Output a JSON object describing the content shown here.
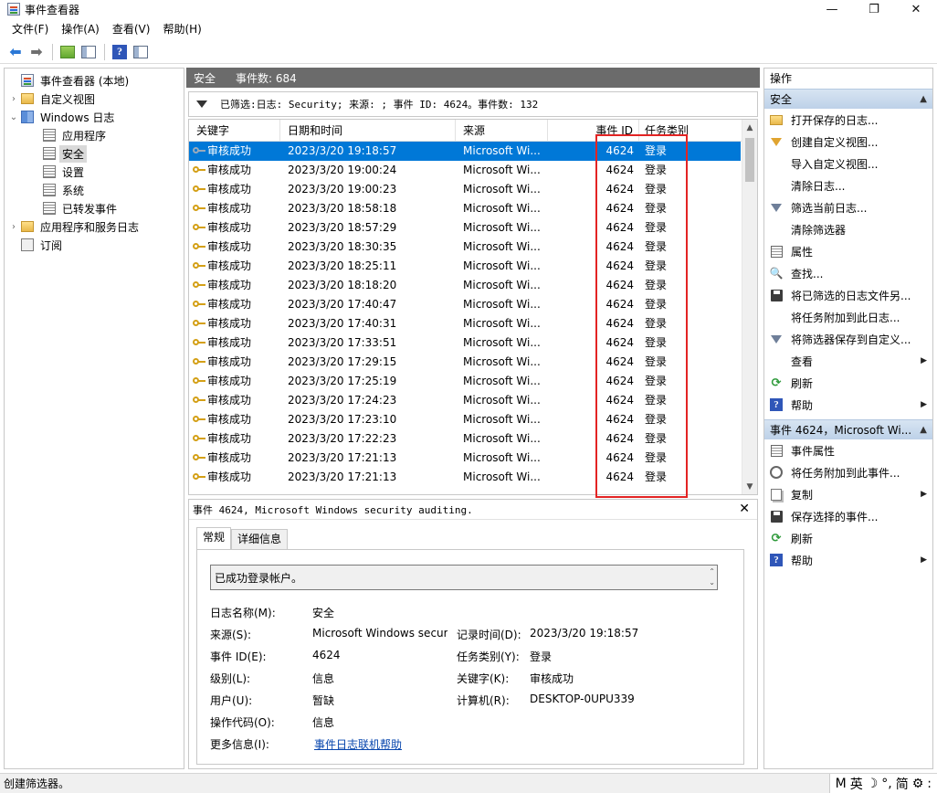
{
  "window": {
    "title": "事件查看器",
    "controls": {
      "minimize": "—",
      "maximize": "❐",
      "close": "✕"
    }
  },
  "menu": [
    "文件(F)",
    "操作(A)",
    "查看(V)",
    "帮助(H)"
  ],
  "tree": {
    "items": [
      {
        "label": "事件查看器 (本地)",
        "icon": "event-viewer-icon",
        "expander": "",
        "indent": 0
      },
      {
        "label": "自定义视图",
        "icon": "folder-icon",
        "expander": "›",
        "indent": 0
      },
      {
        "label": "Windows 日志",
        "icon": "windows-logs-icon",
        "expander": "⌄",
        "indent": 0
      },
      {
        "label": "应用程序",
        "icon": "log-icon",
        "expander": "",
        "indent": 1
      },
      {
        "label": "安全",
        "icon": "log-icon",
        "expander": "",
        "indent": 1,
        "selected": true
      },
      {
        "label": "设置",
        "icon": "log-icon",
        "expander": "",
        "indent": 1
      },
      {
        "label": "系统",
        "icon": "log-icon",
        "expander": "",
        "indent": 1
      },
      {
        "label": "已转发事件",
        "icon": "log-icon",
        "expander": "",
        "indent": 1
      },
      {
        "label": "应用程序和服务日志",
        "icon": "folder-icon",
        "expander": "›",
        "indent": 0
      },
      {
        "label": "订阅",
        "icon": "subscription-icon",
        "expander": "",
        "indent": 0
      }
    ]
  },
  "main": {
    "log_name": "安全",
    "event_count": "事件数: 684",
    "filter_text": "已筛选:日志: Security; 来源: ; 事件 ID: 4624。事件数: 132",
    "columns": [
      "关键字",
      "日期和时间",
      "来源",
      "事件 ID",
      "任务类别"
    ],
    "rows": [
      {
        "kw": "审核成功",
        "dt": "2023/3/20 19:18:57",
        "src": "Microsoft Wi...",
        "id": "4624",
        "task": "登录",
        "selected": true
      },
      {
        "kw": "审核成功",
        "dt": "2023/3/20 19:00:24",
        "src": "Microsoft Wi...",
        "id": "4624",
        "task": "登录"
      },
      {
        "kw": "审核成功",
        "dt": "2023/3/20 19:00:23",
        "src": "Microsoft Wi...",
        "id": "4624",
        "task": "登录"
      },
      {
        "kw": "审核成功",
        "dt": "2023/3/20 18:58:18",
        "src": "Microsoft Wi...",
        "id": "4624",
        "task": "登录"
      },
      {
        "kw": "审核成功",
        "dt": "2023/3/20 18:57:29",
        "src": "Microsoft Wi...",
        "id": "4624",
        "task": "登录"
      },
      {
        "kw": "审核成功",
        "dt": "2023/3/20 18:30:35",
        "src": "Microsoft Wi...",
        "id": "4624",
        "task": "登录"
      },
      {
        "kw": "审核成功",
        "dt": "2023/3/20 18:25:11",
        "src": "Microsoft Wi...",
        "id": "4624",
        "task": "登录"
      },
      {
        "kw": "审核成功",
        "dt": "2023/3/20 18:18:20",
        "src": "Microsoft Wi...",
        "id": "4624",
        "task": "登录"
      },
      {
        "kw": "审核成功",
        "dt": "2023/3/20 17:40:47",
        "src": "Microsoft Wi...",
        "id": "4624",
        "task": "登录"
      },
      {
        "kw": "审核成功",
        "dt": "2023/3/20 17:40:31",
        "src": "Microsoft Wi...",
        "id": "4624",
        "task": "登录"
      },
      {
        "kw": "审核成功",
        "dt": "2023/3/20 17:33:51",
        "src": "Microsoft Wi...",
        "id": "4624",
        "task": "登录"
      },
      {
        "kw": "审核成功",
        "dt": "2023/3/20 17:29:15",
        "src": "Microsoft Wi...",
        "id": "4624",
        "task": "登录"
      },
      {
        "kw": "审核成功",
        "dt": "2023/3/20 17:25:19",
        "src": "Microsoft Wi...",
        "id": "4624",
        "task": "登录"
      },
      {
        "kw": "审核成功",
        "dt": "2023/3/20 17:24:23",
        "src": "Microsoft Wi...",
        "id": "4624",
        "task": "登录"
      },
      {
        "kw": "审核成功",
        "dt": "2023/3/20 17:23:10",
        "src": "Microsoft Wi...",
        "id": "4624",
        "task": "登录"
      },
      {
        "kw": "审核成功",
        "dt": "2023/3/20 17:22:23",
        "src": "Microsoft Wi...",
        "id": "4624",
        "task": "登录"
      },
      {
        "kw": "审核成功",
        "dt": "2023/3/20 17:21:13",
        "src": "Microsoft Wi...",
        "id": "4624",
        "task": "登录"
      },
      {
        "kw": "审核成功",
        "dt": "2023/3/20 17:21:13",
        "src": "Microsoft Wi...",
        "id": "4624",
        "task": "登录"
      }
    ]
  },
  "detail": {
    "header": "事件 4624, Microsoft Windows security auditing.",
    "tabs": [
      "常规",
      "详细信息"
    ],
    "description": "已成功登录帐户。",
    "labels": {
      "log_name": "日志名称(M):",
      "source": "来源(S):",
      "event_id": "事件 ID(E):",
      "level": "级别(L):",
      "user": "用户(U):",
      "opcode": "操作代码(O):",
      "more_info": "更多信息(I):",
      "logged": "记录时间(D):",
      "task_category": "任务类别(Y):",
      "keywords": "关键字(K):",
      "computer": "计算机(R):"
    },
    "values": {
      "log_name": "安全",
      "source": "Microsoft Windows secur",
      "event_id": "4624",
      "level": "信息",
      "user": "暂缺",
      "opcode": "信息",
      "more_info_link": "事件日志联机帮助",
      "logged": "2023/3/20 19:18:57",
      "task_category": "登录",
      "keywords": "审核成功",
      "computer": "DESKTOP-0UPU339"
    }
  },
  "actions": {
    "title": "操作",
    "section1": "安全",
    "items1": [
      {
        "label": "打开保存的日志...",
        "icon": "open-log-icon",
        "sub": false
      },
      {
        "label": "创建自定义视图...",
        "icon": "create-view-icon",
        "sub": false
      },
      {
        "label": "导入自定义视图...",
        "icon": "",
        "sub": false
      },
      {
        "label": "清除日志...",
        "icon": "",
        "sub": false
      },
      {
        "label": "筛选当前日志...",
        "icon": "filter-icon",
        "sub": false
      },
      {
        "label": "清除筛选器",
        "icon": "",
        "sub": false
      },
      {
        "label": "属性",
        "icon": "properties-icon",
        "sub": false
      },
      {
        "label": "查找...",
        "icon": "find-icon",
        "sub": false
      },
      {
        "label": "将已筛选的日志文件另...",
        "icon": "save-icon",
        "sub": false
      },
      {
        "label": "将任务附加到此日志...",
        "icon": "",
        "sub": false
      },
      {
        "label": "将筛选器保存到自定义...",
        "icon": "save-filter-icon",
        "sub": false
      },
      {
        "label": "查看",
        "icon": "",
        "sub": true
      },
      {
        "label": "刷新",
        "icon": "refresh-icon",
        "sub": false
      },
      {
        "label": "帮助",
        "icon": "help-icon",
        "sub": true
      }
    ],
    "section2": "事件 4624，Microsoft Wi...",
    "items2": [
      {
        "label": "事件属性",
        "icon": "properties-icon",
        "sub": false
      },
      {
        "label": "将任务附加到此事件...",
        "icon": "task-icon",
        "sub": false
      },
      {
        "label": "复制",
        "icon": "copy-icon",
        "sub": true
      },
      {
        "label": "保存选择的事件...",
        "icon": "save-icon",
        "sub": false
      },
      {
        "label": "刷新",
        "icon": "refresh-icon",
        "sub": false
      },
      {
        "label": "帮助",
        "icon": "help-icon",
        "sub": true
      }
    ]
  },
  "status": {
    "text": "创建筛选器。",
    "ime": [
      "M",
      "英",
      "☽",
      "°,",
      "简",
      "⚙",
      ":"
    ]
  },
  "colors": {
    "selection": "#0078d7",
    "highlight_box": "#e32424",
    "header_bg": "#6b6b6b"
  }
}
